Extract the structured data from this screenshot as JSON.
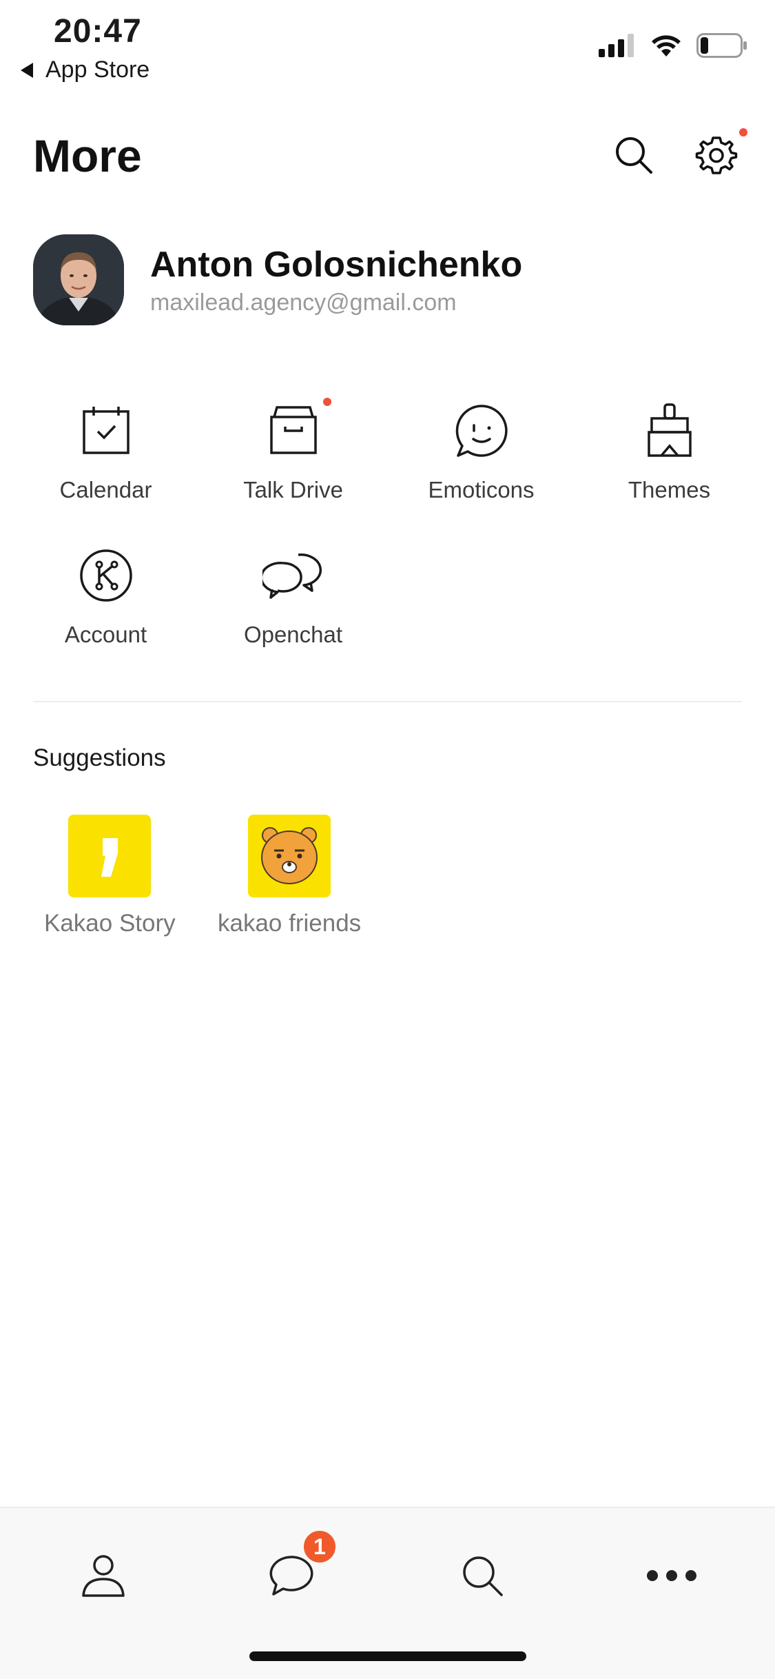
{
  "status": {
    "time": "20:47",
    "back_label": "App Store",
    "battery_level_percent": 20
  },
  "header": {
    "title": "More",
    "search_icon": "search-icon",
    "settings_icon": "gear-icon"
  },
  "profile": {
    "name": "Anton Golosnichenko",
    "email": "maxilead.agency@gmail.com"
  },
  "menu": [
    {
      "label": "Calendar",
      "icon": "calendar-icon"
    },
    {
      "label": "Talk Drive",
      "icon": "drive-box-icon",
      "dot": true
    },
    {
      "label": "Emoticons",
      "icon": "emoticon-icon"
    },
    {
      "label": "Themes",
      "icon": "paintbrush-icon"
    },
    {
      "label": "Account",
      "icon": "kakao-account-icon"
    },
    {
      "label": "Openchat",
      "icon": "openchat-bubbles-icon"
    }
  ],
  "suggestions": {
    "title": "Suggestions",
    "items": [
      {
        "label": "Kakao Story",
        "icon": "kakao-story-icon"
      },
      {
        "label": "kakao friends",
        "icon": "kakao-friends-icon"
      }
    ]
  },
  "tabbar": {
    "chats_badge": "1",
    "tabs": [
      "person-icon",
      "chat-bubble-icon",
      "search-icon",
      "more-dots-icon"
    ]
  },
  "colors": {
    "accent_red": "#f0503c",
    "kakao_yellow": "#fae100",
    "badge_orange": "#f05a2b"
  }
}
